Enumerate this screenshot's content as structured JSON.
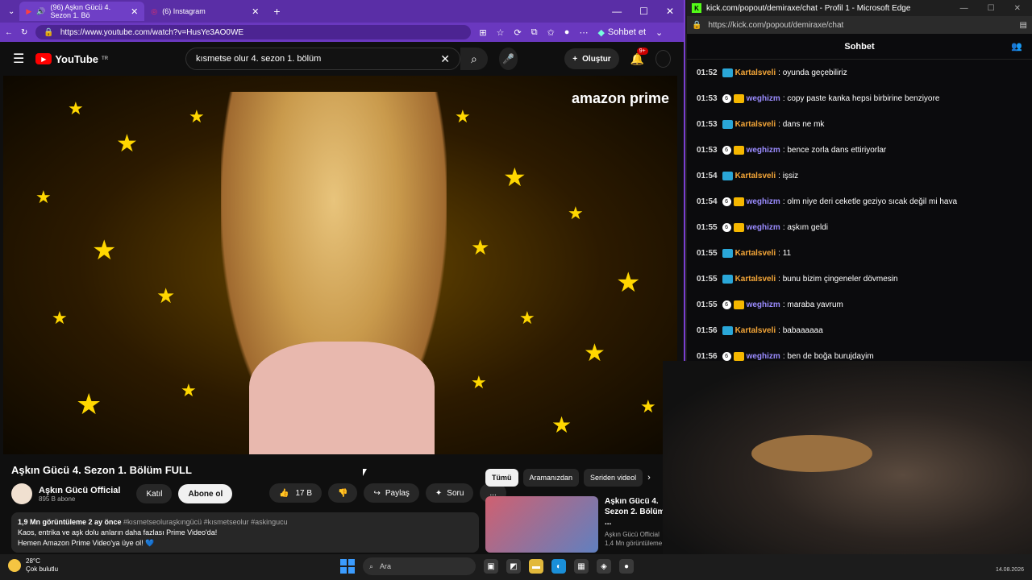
{
  "browser_left": {
    "tabs": [
      {
        "label": "(96) Aşkın Gücü 4. Sezon 1. Bö",
        "active": true
      },
      {
        "label": "(6) Instagram",
        "active": false
      }
    ],
    "url": "https://www.youtube.com/watch?v=HusYe3AO0WE",
    "copilot_label": "Sohbet et"
  },
  "youtube": {
    "logo_text": "YouTube",
    "logo_region": "TR",
    "search_value": "kısmetse olur 4. sezon 1. bölüm",
    "create_label": "Oluştur",
    "notif_badge": "9+",
    "video_overlay": "amazon prime",
    "video_title": "Aşkın Gücü 4. Sezon 1. Bölüm FULL",
    "channel_name": "Aşkın Gücü Official",
    "channel_subs": "895 B abone",
    "join_label": "Katıl",
    "subscribe_label": "Abone ol",
    "likes": "17 B",
    "share_label": "Paylaş",
    "ask_label": "Soru",
    "more_label": "...",
    "desc_meta": "1,9 Mn görüntüleme  2 ay önce",
    "desc_tags": "#kısmetseoluraşkıngücü #kısmetseolur #askingucu",
    "desc_line1": "Kaos, entrika ve aşk dolu anların daha fazlası Prime Video'da!",
    "desc_line2": "Hemen Amazon Prime Video'ya üye ol! 💙",
    "chips": [
      "Tümü",
      "Aramanızdan",
      "Seriden videol"
    ],
    "rec_title": "Aşkın Gücü 4. Sezon 2. Bölüm ...",
    "rec_channel": "Aşkın Gücü Official",
    "rec_views": "1,4 Mn görüntüleme"
  },
  "browser_right": {
    "title": "kick.com/popout/demiraxe/chat - Profil 1 - Microsoft Edge",
    "url": "https://kick.com/popout/demiraxe/chat",
    "chat_title": "Sohbet"
  },
  "chat": [
    {
      "time": "01:52",
      "user": "Kartalsveli",
      "text": "oyunda geçebiliriz",
      "type": "k"
    },
    {
      "time": "01:53",
      "user": "weghizm",
      "text": "copy paste kanka hepsi birbirine benziyore",
      "type": "w"
    },
    {
      "time": "01:53",
      "user": "Kartalsveli",
      "text": "dans ne mk",
      "type": "k"
    },
    {
      "time": "01:53",
      "user": "weghizm",
      "text": "bence zorla dans ettiriyorlar",
      "type": "w"
    },
    {
      "time": "01:54",
      "user": "Kartalsveli",
      "text": "işsiz",
      "type": "k"
    },
    {
      "time": "01:54",
      "user": "weghizm",
      "text": "olm niye deri ceketle geziyo sıcak değil mi hava",
      "type": "w"
    },
    {
      "time": "01:55",
      "user": "weghizm",
      "text": "aşkım geldi",
      "type": "w"
    },
    {
      "time": "01:55",
      "user": "Kartalsveli",
      "text": "11",
      "type": "k"
    },
    {
      "time": "01:55",
      "user": "Kartalsveli",
      "text": "bunu bizim çingeneler dövmesin",
      "type": "k"
    },
    {
      "time": "01:55",
      "user": "weghizm",
      "text": "maraba yavrum",
      "type": "w"
    },
    {
      "time": "01:56",
      "user": "Kartalsveli",
      "text": "babaaaaaa",
      "type": "k"
    },
    {
      "time": "01:56",
      "user": "weghizm",
      "text": "ben de boğa burujdayim",
      "type": "w"
    }
  ],
  "taskbar": {
    "temp": "28°C",
    "weather": "Çok bulutlu",
    "search_placeholder": "Ara",
    "date": "14.08.2026"
  }
}
